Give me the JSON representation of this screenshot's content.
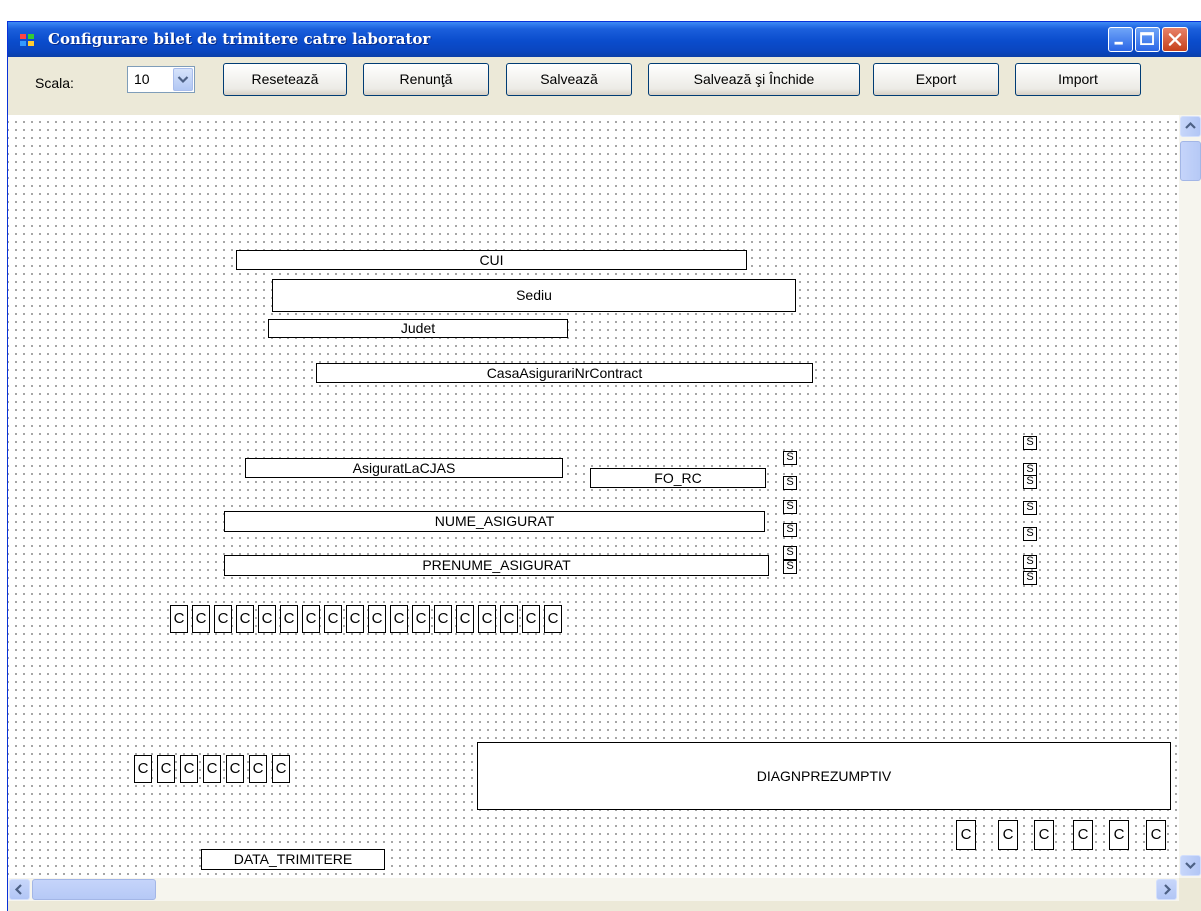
{
  "window": {
    "title": "Configurare bilet de trimitere catre laborator",
    "accent_color": "#0a4ccc"
  },
  "toolbar": {
    "scala_label": "Scala:",
    "scala_value": "10",
    "reseteaza_label": "Resetează",
    "renunta_label": "Renunţă",
    "salveaza_label": "Salvează",
    "salveaza_inchide_label": "Salvează şi Închide",
    "export_label": "Export",
    "import_label": "Import"
  },
  "canvas": {
    "fields": {
      "cui": "CUI",
      "sediu": "Sediu",
      "judet": "Judet",
      "casa_asigurari": "CasaAsigurariNrContract",
      "asigurat_la_cjas": "AsiguratLaCJAS",
      "fo_rc": "FO_RC",
      "nume_asigurat": "NUME_ASIGURAT",
      "prenume_asigurat": "PRENUME_ASIGURAT",
      "diagn_prezumptiv": "DIAGNPREZUMPTIV",
      "data_trimitere": "DATA_TRIMITERE"
    },
    "char_box_label": "C",
    "small_box_label": "S"
  },
  "icons": {
    "app": "app-window-icon",
    "minimize": "minimize-icon",
    "maximize": "maximize-icon",
    "close": "close-icon",
    "dropdown": "chevron-down-icon"
  }
}
